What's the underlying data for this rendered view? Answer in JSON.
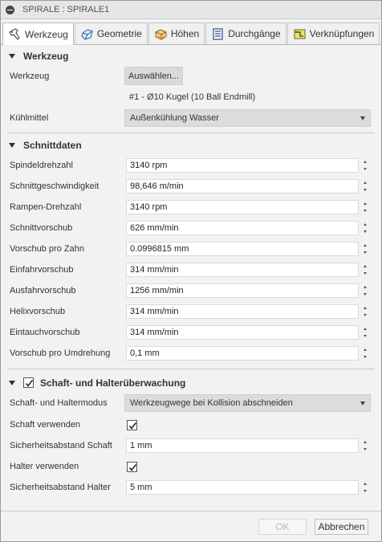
{
  "title": "SPIRALE : SPIRALE1",
  "tabs": [
    {
      "label": "Werkzeug",
      "icon": "tool-icon"
    },
    {
      "label": "Geometrie",
      "icon": "geometry-icon"
    },
    {
      "label": "Höhen",
      "icon": "heights-icon"
    },
    {
      "label": "Durchgänge",
      "icon": "passes-icon"
    },
    {
      "label": "Verknüpfungen",
      "icon": "linking-icon"
    }
  ],
  "werkzeug": {
    "heading": "Werkzeug",
    "tool_label": "Werkzeug",
    "select_button": "Auswählen...",
    "tool_info": "#1 - Ø10 Kugel (10 Ball Endmill)",
    "coolant_label": "Kühlmittel",
    "coolant_value": "Außenkühlung Wasser"
  },
  "schnittdaten": {
    "heading": "Schnittdaten",
    "fields": [
      {
        "label": "Spindeldrehzahl",
        "value": "3140 rpm"
      },
      {
        "label": "Schnittgeschwindigkeit",
        "value": "98,646 m/min"
      },
      {
        "label": "Rampen-Drehzahl",
        "value": "3140 rpm"
      },
      {
        "label": "Schnittvorschub",
        "value": "626 mm/min"
      },
      {
        "label": "Vorschub pro Zahn",
        "value": " 0.0996815 mm"
      },
      {
        "label": "Einfahrvorschub",
        "value": "314 mm/min"
      },
      {
        "label": "Ausfahrvorschub",
        "value": "1256 mm/min"
      },
      {
        "label": "Helixvorschub",
        "value": "314 mm/min"
      },
      {
        "label": "Eintauchvorschub",
        "value": "314 mm/min"
      },
      {
        "label": "Vorschub pro Umdrehung",
        "value": "0,1 mm"
      }
    ]
  },
  "schaft": {
    "heading": "Schaft- und Halterüberwachung",
    "mode_label": "Schaft- und Haltermodus",
    "mode_value": "Werkzeugwege bei Kollision abschneiden",
    "use_shaft_label": "Schaft verwenden",
    "shaft_clearance_label": "Sicherheitsabstand Schaft",
    "shaft_clearance_value": "1 mm",
    "use_holder_label": "Halter verwenden",
    "holder_clearance_label": "Sicherheitsabstand Halter",
    "holder_clearance_value": "5 mm"
  },
  "footer": {
    "ok": "OK",
    "cancel": "Abbrechen"
  }
}
